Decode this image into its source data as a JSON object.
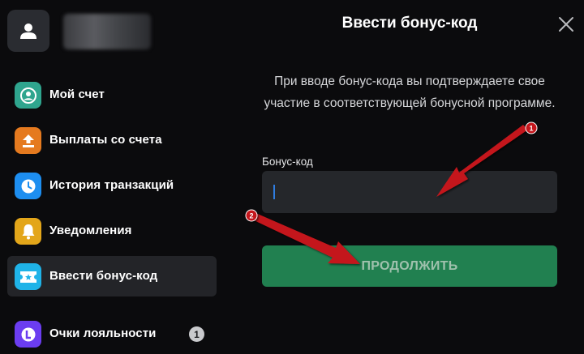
{
  "sidebar": {
    "items": [
      {
        "label": "Мой счет",
        "icon": "account-icon",
        "color": "#2fa58e"
      },
      {
        "label": "Выплаты со счета",
        "icon": "upload-icon",
        "color": "#e57a1f"
      },
      {
        "label": "История транзакций",
        "icon": "clock-icon",
        "color": "#1d8ef0"
      },
      {
        "label": "Уведомления",
        "icon": "bell-icon",
        "color": "#e3a61a"
      },
      {
        "label": "Ввести бонус-код",
        "icon": "ticket-icon",
        "color": "#1fb3e8",
        "active": true
      },
      {
        "label": "Очки лояльности",
        "icon": "loyalty-icon",
        "color": "#6b3df0",
        "badge": "1"
      }
    ]
  },
  "panel": {
    "title": "Ввести бонус-код",
    "description": "При вводе бонус-кода вы подтверждаете свое участие в соответствующей бонусной программе.",
    "field_label": "Бонус-код",
    "input_value": "",
    "button_label": "ПРОДОЛЖИТЬ"
  },
  "annotations": {
    "marker_1": "1",
    "marker_2": "2",
    "arrow_color": "#c4171c"
  }
}
